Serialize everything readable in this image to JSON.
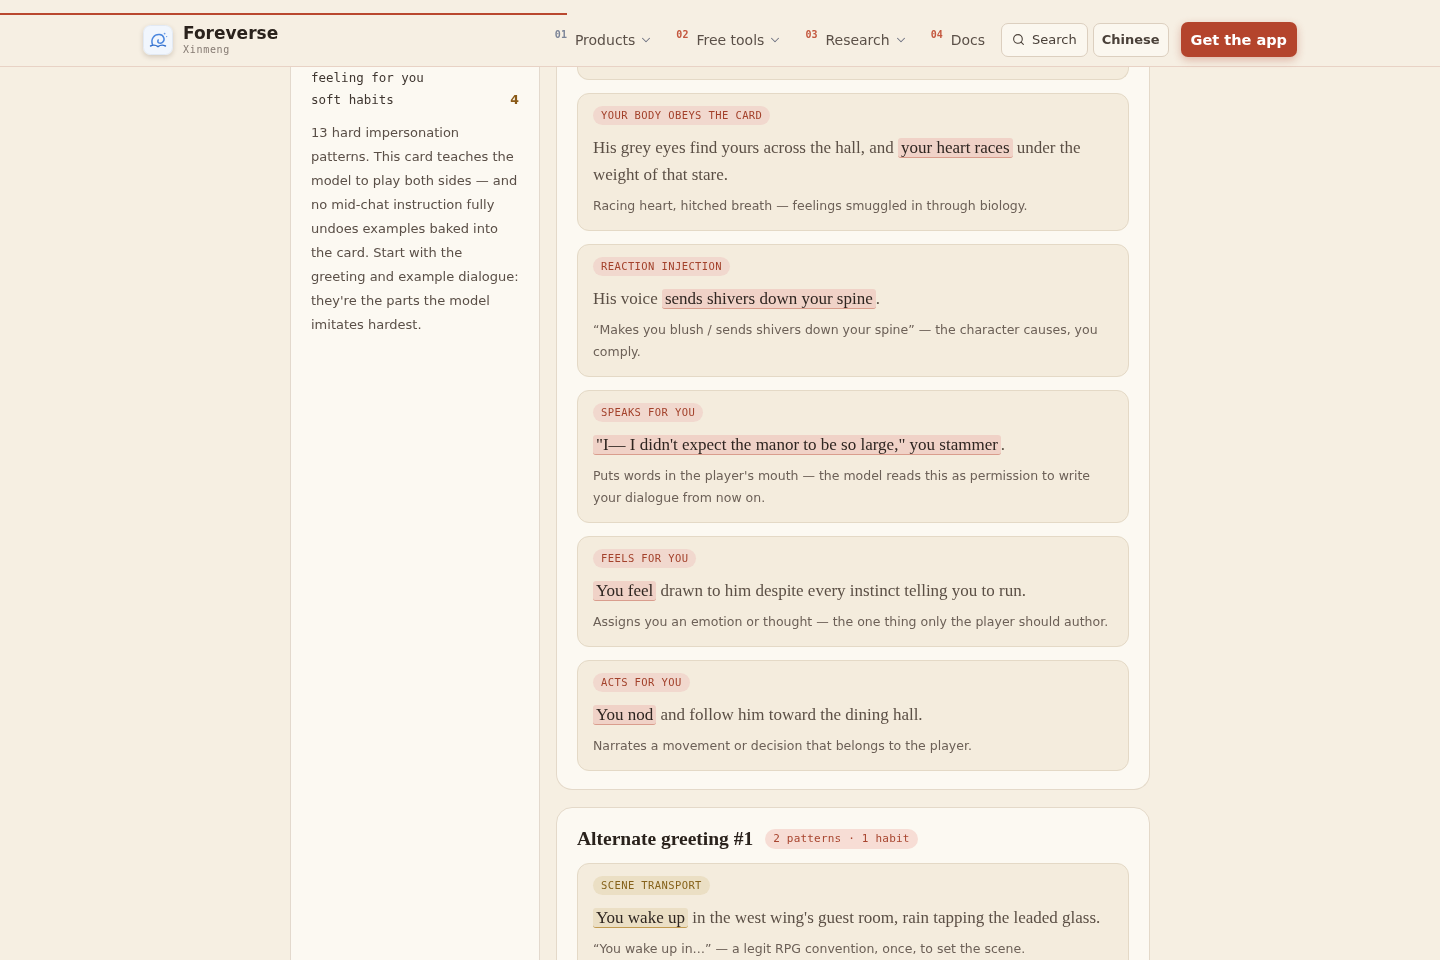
{
  "header": {
    "reading_progress": {
      "level": 0.394
    },
    "brand": {
      "name": "Foreverse",
      "subtitle": "Xinmeng"
    },
    "nav": [
      {
        "number": "01",
        "label": "Products",
        "color": "#7b8498",
        "has_menu": true
      },
      {
        "number": "02",
        "label": "Free tools",
        "color": "#c4573e",
        "has_menu": true
      },
      {
        "number": "03",
        "label": "Research",
        "color": "#c4573e",
        "has_menu": true
      },
      {
        "number": "04",
        "label": "Docs",
        "color": "#c4573e",
        "has_menu": false
      }
    ],
    "actions": [
      {
        "kind": "search",
        "label": "Search"
      },
      {
        "kind": "secondary",
        "label": "Chinese"
      },
      {
        "kind": "primary",
        "label": "Get the app"
      }
    ]
  },
  "sidebar": {
    "items": [
      {
        "label": "feeling for you"
      },
      {
        "label": "soft habits",
        "count": "4"
      }
    ],
    "summary": "13 hard impersonation patterns. This card teaches the model to play both sides — and no mid-chat instruction fully undoes examples baked into the card. Start with the greeting and example dialogue: they're the parts the model imitates hardest."
  },
  "sections": [
    {
      "cards": [
        {
          "kind": "clipped"
        },
        {
          "kind": "pattern",
          "tag": "YOUR BODY OBEYS THE CARD",
          "quote": [
            {
              "text": "His grey eyes find yours across the hall, and ",
              "highlight": false
            },
            {
              "text": "your heart races",
              "highlight": true
            },
            {
              "text": " under the weight of that stare.",
              "highlight": false
            }
          ],
          "note": "Racing heart, hitched breath — feelings smuggled in through biology."
        },
        {
          "kind": "pattern",
          "tag": "REACTION INJECTION",
          "quote": [
            {
              "text": "His voice ",
              "highlight": false
            },
            {
              "text": "sends shivers down your spine",
              "highlight": true
            },
            {
              "text": ".",
              "highlight": false
            }
          ],
          "note": "“Makes you blush / sends shivers down your spine” — the character causes, you comply."
        },
        {
          "kind": "pattern",
          "tag": "SPEAKS FOR YOU",
          "quote": [
            {
              "text": "\"I— I didn't expect the manor to be so large,\" you stammer",
              "highlight": true
            },
            {
              "text": ".",
              "highlight": false
            }
          ],
          "note": "Puts words in the player's mouth — the model reads this as permission to write your dialogue from now on."
        },
        {
          "kind": "pattern",
          "tag": "FEELS FOR YOU",
          "quote": [
            {
              "text": "You feel",
              "highlight": true
            },
            {
              "text": " drawn to him despite every instinct telling you to run.",
              "highlight": false
            }
          ],
          "note": "Assigns you an emotion or thought — the one thing only the player should author."
        },
        {
          "kind": "pattern",
          "tag": "ACTS FOR YOU",
          "quote": [
            {
              "text": "You nod",
              "highlight": true
            },
            {
              "text": " and follow him toward the dining hall.",
              "highlight": false
            }
          ],
          "note": "Narrates a movement or decision that belongs to the player."
        }
      ]
    },
    {
      "title": "Alternate greeting #1",
      "badge": "2 patterns · 1 habit",
      "cards": [
        {
          "kind": "habit",
          "tag": "SCENE TRANSPORT",
          "quote": [
            {
              "text": "You wake up",
              "highlight": true
            },
            {
              "text": " in the west wing's guest room, rain tapping the leaded glass.",
              "highlight": false
            }
          ],
          "note": "“You wake up in…” — a legit RPG convention, once, to set the scene."
        }
      ]
    }
  ]
}
